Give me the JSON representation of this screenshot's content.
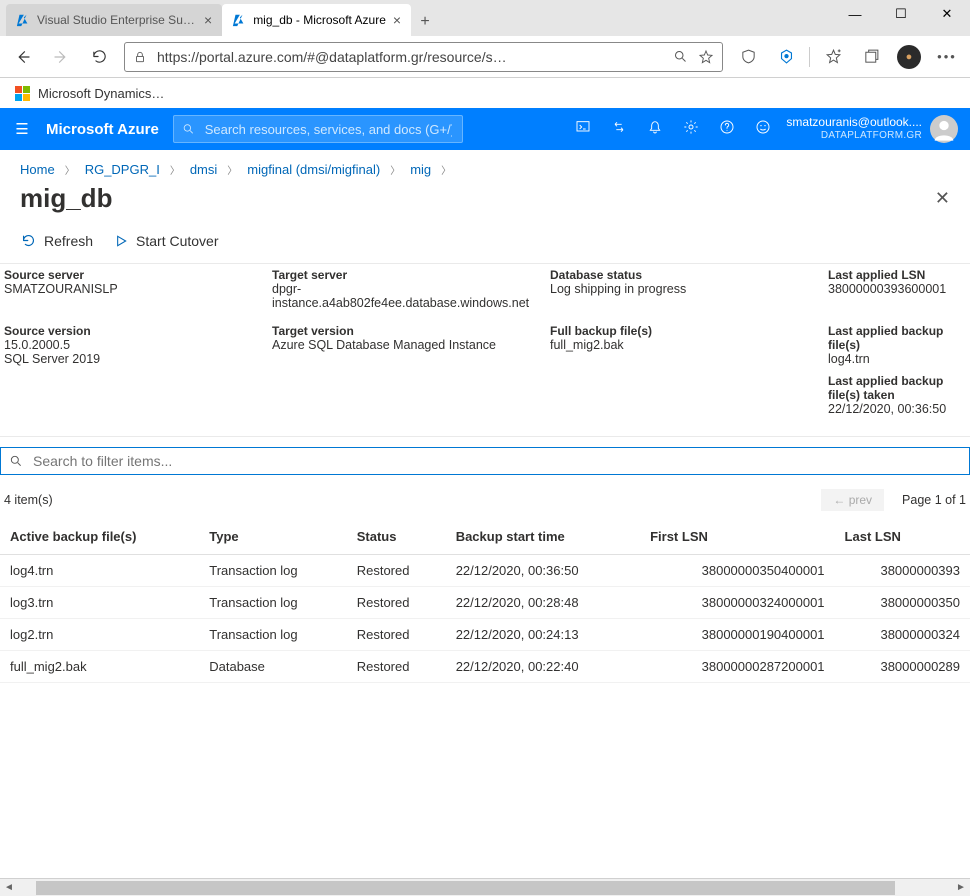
{
  "window": {
    "tabs": [
      {
        "title": "Visual Studio Enterprise Subscription",
        "icon": "azure"
      },
      {
        "title": "mig_db - Microsoft Azure",
        "icon": "azure"
      }
    ],
    "url": "https://portal.azure.com/#@dataplatform.gr/resource/s…",
    "bookmark": "Microsoft Dynamics…"
  },
  "azure_header": {
    "brand": "Microsoft Azure",
    "search_placeholder": "Search resources, services, and docs (G+/)",
    "account_email": "smatzouranis@outlook....",
    "tenant": "DATAPLATFORM.GR"
  },
  "breadcrumbs": [
    "Home",
    "RG_DPGR_I",
    "dmsi",
    "migfinal (dmsi/migfinal)",
    "mig"
  ],
  "page": {
    "title": "mig_db",
    "refresh_label": "Refresh",
    "cutover_label": "Start Cutover"
  },
  "essentials": {
    "source_server_label": "Source server",
    "source_server": "SMATZOURANISLP",
    "target_server_label": "Target server",
    "target_server": "dpgr-instance.a4ab802fe4ee.database.windows.net",
    "db_status_label": "Database status",
    "db_status": "Log shipping in progress",
    "last_lsn_label": "Last applied LSN",
    "last_lsn": "38000000393600001",
    "src_version_label": "Source version",
    "src_version_a": "15.0.2000.5",
    "src_version_b": "SQL Server 2019",
    "tgt_version_label": "Target version",
    "tgt_version": "Azure SQL Database Managed Instance",
    "full_backup_label": "Full backup file(s)",
    "full_backup": "full_mig2.bak",
    "last_bak_label": "Last applied backup file(s)",
    "last_bak": "log4.trn",
    "last_bak_taken_label": "Last applied backup file(s) taken",
    "last_bak_taken": "22/12/2020, 00:36:50"
  },
  "filter_placeholder": "Search to filter items...",
  "list": {
    "count_text": "4 item(s)",
    "prev_label": "← prev",
    "page_text": "Page 1 of 1",
    "headers": {
      "file": "Active backup file(s)",
      "type": "Type",
      "status": "Status",
      "start": "Backup start time",
      "first_lsn": "First LSN",
      "last_lsn": "Last LSN"
    },
    "rows": [
      {
        "file": "log4.trn",
        "type": "Transaction log",
        "status": "Restored",
        "start": "22/12/2020, 00:36:50",
        "first_lsn": "38000000350400001",
        "last_lsn": "38000000393"
      },
      {
        "file": "log3.trn",
        "type": "Transaction log",
        "status": "Restored",
        "start": "22/12/2020, 00:28:48",
        "first_lsn": "38000000324000001",
        "last_lsn": "38000000350"
      },
      {
        "file": "log2.trn",
        "type": "Transaction log",
        "status": "Restored",
        "start": "22/12/2020, 00:24:13",
        "first_lsn": "38000000190400001",
        "last_lsn": "38000000324"
      },
      {
        "file": "full_mig2.bak",
        "type": "Database",
        "status": "Restored",
        "start": "22/12/2020, 00:22:40",
        "first_lsn": "38000000287200001",
        "last_lsn": "38000000289"
      }
    ]
  }
}
